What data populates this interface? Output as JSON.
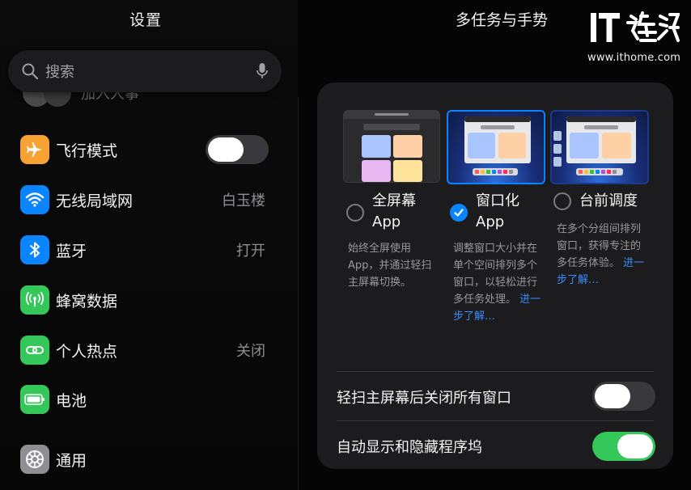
{
  "sidebar": {
    "title": "设置",
    "profile_name": "加入人事",
    "search": {
      "placeholder": "搜索"
    },
    "items": [
      {
        "label": "飞行模式",
        "value": "",
        "icon": "airplane-icon",
        "color": "#f7a233",
        "toggle": "off"
      },
      {
        "label": "无线局域网",
        "value": "白玉楼",
        "icon": "wifi-icon",
        "color": "#0a84ff"
      },
      {
        "label": "蓝牙",
        "value": "打开",
        "icon": "bluetooth-icon",
        "color": "#0a84ff"
      },
      {
        "label": "蜂窝数据",
        "value": "",
        "icon": "cellular-icon",
        "color": "#34c759"
      },
      {
        "label": "个人热点",
        "value": "关闭",
        "icon": "hotspot-icon",
        "color": "#34c759"
      },
      {
        "label": "电池",
        "value": "",
        "icon": "battery-icon",
        "color": "#34c759"
      },
      {
        "label": "通用",
        "value": "",
        "icon": "gear-icon",
        "color": "#8e8e93"
      }
    ]
  },
  "detail": {
    "title": "多任务与手势",
    "options": [
      {
        "label_line1": "全屏幕",
        "label_line2": "App",
        "selected": false,
        "desc": "始终全屏使用App，并通过轻扫主屏幕切换。",
        "more": ""
      },
      {
        "label_line1": "窗口化",
        "label_line2": "App",
        "selected": true,
        "desc": "调整窗口大小并在单个空间排列多个窗口，以轻松进行多任务处理。",
        "more": "进一步了解…"
      },
      {
        "label_line1": "台前调度",
        "label_line2": "",
        "selected": false,
        "desc": "在多个分组间排列窗口，获得专注的多任务体验。",
        "more": "进一步了解…"
      }
    ],
    "toggles": [
      {
        "label": "轻扫主屏幕后关闭所有窗口",
        "state": "off"
      },
      {
        "label": "自动显示和隐藏程序坞",
        "state": "on"
      }
    ]
  },
  "watermark": {
    "logo": "IT之家",
    "url": "www.ithome.com"
  },
  "colors": {
    "accent": "#0a84ff",
    "switch_on": "#34c759",
    "link": "#3a8cff"
  }
}
